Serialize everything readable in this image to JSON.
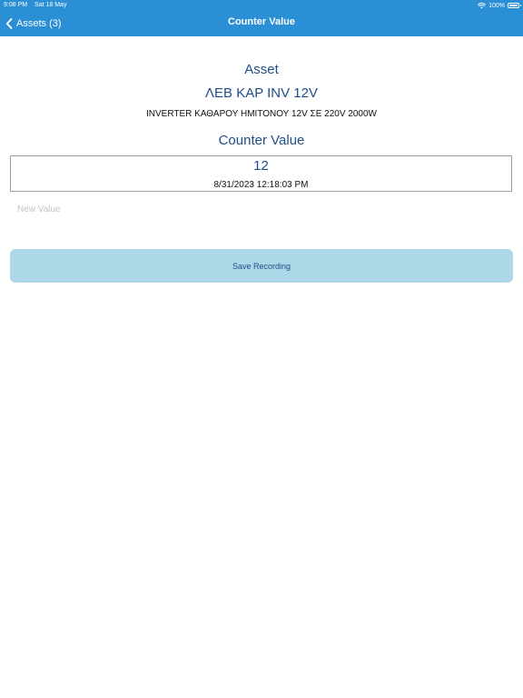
{
  "status_bar": {
    "time": "9:08 PM",
    "date": "Sat 18 May",
    "battery": "100%"
  },
  "nav_bar": {
    "back_label": "Assets (3)",
    "title": "Counter Value"
  },
  "asset": {
    "heading": "Asset",
    "code": "ΛΕΒ ΚΑΡ INV 12V",
    "description": "INVERTER ΚΑΘΑΡΟΥ ΗΜΙΤΟΝΟΥ 12V ΣΕ 220V 2000W"
  },
  "counter": {
    "heading": "Counter Value",
    "value": "12",
    "timestamp": "8/31/2023 12:18:03 PM"
  },
  "new_value": {
    "placeholder": "New Value",
    "value": ""
  },
  "save_button": {
    "label": "Save Recording"
  },
  "colors": {
    "nav_bar": "#2a8fd4",
    "accent_text": "#1d4e89",
    "save_button": "#acd8e7"
  }
}
